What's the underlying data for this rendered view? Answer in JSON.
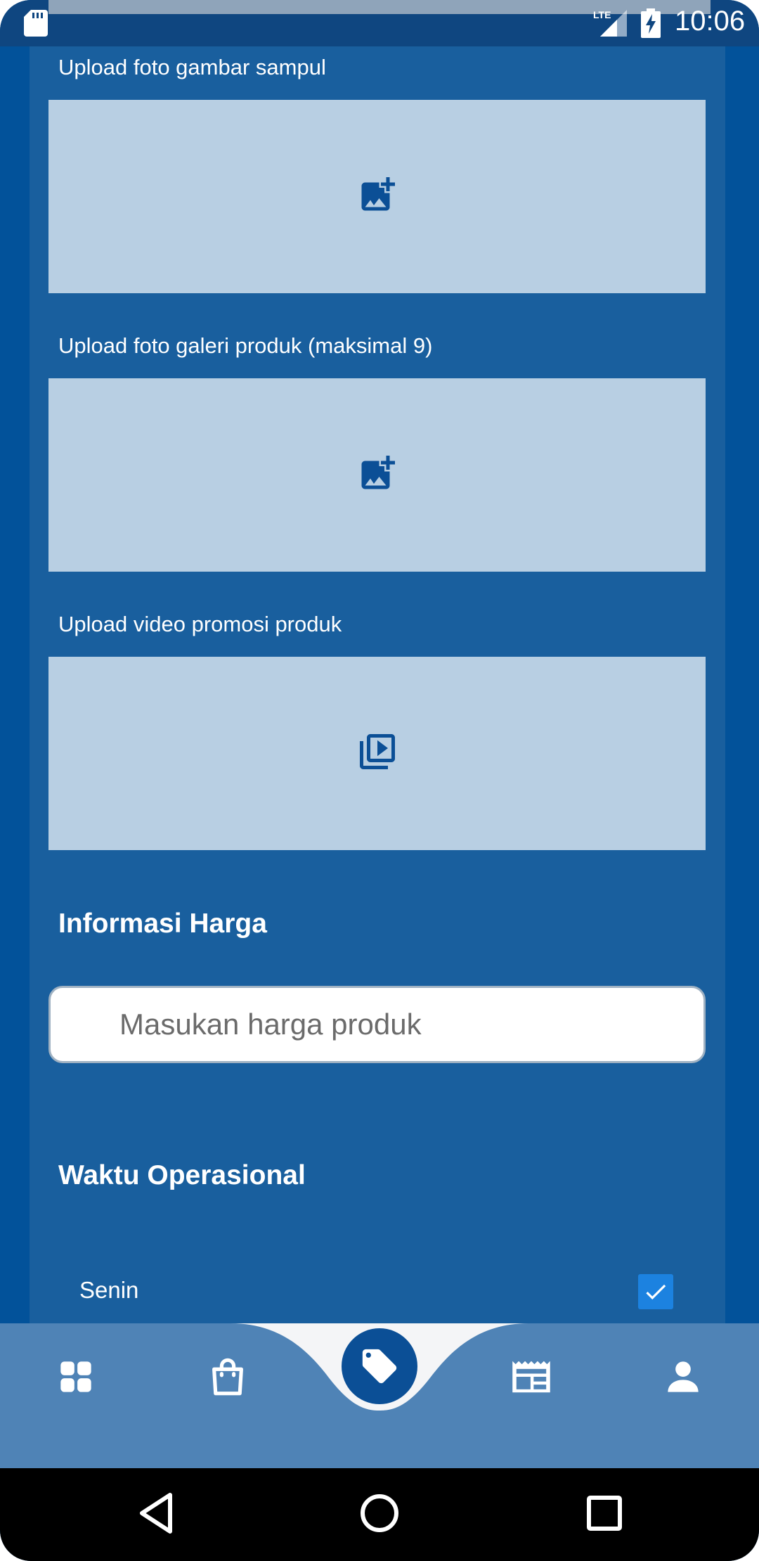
{
  "status_bar": {
    "time": "10:06",
    "network": "LTE",
    "icons": [
      "sd-card-icon",
      "lte-signal-icon",
      "battery-charging-icon"
    ]
  },
  "uploads": {
    "cover_label": "Upload foto gambar sampul",
    "gallery_label": "Upload foto galeri produk (maksimal 9)",
    "video_label": "Upload video promosi produk",
    "cover_icon": "add-photo-icon",
    "gallery_icon": "add-photo-icon",
    "video_icon": "video-library-icon"
  },
  "price": {
    "heading": "Informasi Harga",
    "placeholder": "Masukan harga produk",
    "value": ""
  },
  "operational": {
    "heading": "Waktu Operasional",
    "days": [
      {
        "label": "Senin",
        "checked": true
      }
    ]
  },
  "bottom_nav": {
    "items": [
      "dashboard-icon",
      "shopping-bag-icon",
      "tag-icon",
      "newspaper-icon",
      "person-icon"
    ],
    "active": "tag-icon"
  },
  "system_nav": [
    "back-icon",
    "home-icon",
    "recents-icon"
  ],
  "colors": {
    "background": "#02529a",
    "panel": "#195f9e",
    "upload_box": "#b8cfe3",
    "icon_blue": "#0b4f96",
    "nav_bar": "#4f83b6",
    "checkbox": "#1c82e0"
  }
}
